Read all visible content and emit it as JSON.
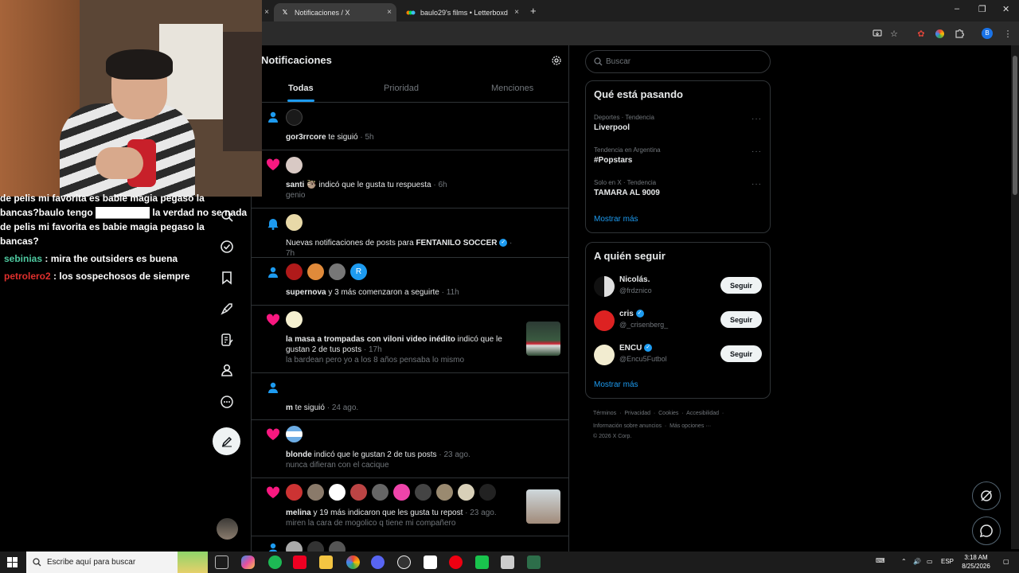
{
  "browser": {
    "tabs": [
      {
        "title": "",
        "close": "×"
      },
      {
        "title": "Notificaciones / X",
        "close": "×",
        "favicon": "x-logo-icon"
      },
      {
        "title": "baulo29's films • Letterboxd",
        "close": "×",
        "favicon": "letterboxd-icon"
      }
    ],
    "new_tab": "+",
    "window_controls": [
      "–",
      "❐",
      "✕"
    ]
  },
  "stream_chat": {
    "lines": [
      {
        "user": "",
        "user_color": "#ffffff",
        "text": "de pelis mi favorita es babie magia pegaso la"
      },
      {
        "user": "",
        "user_color": "#ffffff",
        "text": "bancas?baulo tengo ████████ la verdad no se nada"
      },
      {
        "user": "",
        "user_color": "#ffffff",
        "text": "de pelis mi favorita es babie magia pegaso la"
      },
      {
        "user": "",
        "user_color": "#ffffff",
        "text": "bancas?"
      },
      {
        "user": "sebinias",
        "user_color": "#4ec9a0",
        "text": ": mira the outsiders es buena"
      },
      {
        "user": "petrolero2",
        "user_color": "#e0302d",
        "text": ": los sospechosos de siempre"
      }
    ]
  },
  "main": {
    "title": "Notificaciones",
    "tabs": [
      {
        "label": "Todas",
        "active": true
      },
      {
        "label": "Prioridad",
        "active": false
      },
      {
        "label": "Menciones",
        "active": false
      }
    ],
    "notifications": [
      {
        "type": "follow",
        "icon": "person-icon",
        "user": "gor3rrcore",
        "text": " te siguió",
        "time": " · 5h",
        "sub": ""
      },
      {
        "type": "like",
        "icon": "heart-icon",
        "user": "santi 🦥",
        "text": " indicó que le gusta tu respuesta",
        "time": " · 6h",
        "sub": "genio"
      },
      {
        "type": "bell",
        "icon": "bell-icon",
        "user": "",
        "text": "Nuevas notificaciones de posts para ",
        "bold2": "FENTANILO SOCCER",
        "time": " · 7h",
        "sub": ""
      },
      {
        "type": "follow",
        "icon": "person-icon",
        "user": "supernova",
        "text": " y 3 más comenzaron a seguirte",
        "time": " · 11h",
        "sub": ""
      },
      {
        "type": "like",
        "icon": "heart-icon",
        "user": "la masa a trompadas con viloni video inédito",
        "text": " indicó que le gustan 2 de tus posts",
        "time": " · 17h",
        "sub": "la bardean pero yo a los 8 años pensaba lo mismo"
      },
      {
        "type": "follow",
        "icon": "person-icon",
        "user": "m",
        "text": " te siguió",
        "time": " · 24 ago.",
        "sub": ""
      },
      {
        "type": "like",
        "icon": "heart-icon",
        "user": "blonde",
        "text": " indicó que le gustan 2 de tus posts",
        "time": " · 23 ago.",
        "sub": "nunca difieran con el cacique"
      },
      {
        "type": "like",
        "icon": "heart-icon",
        "user": "melina",
        "text": " y 19 más indicaron que les gusta tu repost",
        "time": " · 23 ago.",
        "sub": "miren la cara de mogolico q tiene mi compañero"
      }
    ]
  },
  "right": {
    "search_placeholder": "Buscar",
    "trends_title": "Qué está pasando",
    "trends": [
      {
        "meta": "Deportes · Tendencia",
        "name": "Liverpool"
      },
      {
        "meta": "Tendencia en Argentina",
        "name": "#Popstars"
      },
      {
        "meta": "Solo en X · Tendencia",
        "name": "TAMARA AL 9009"
      }
    ],
    "trends_more": "Mostrar más",
    "who_title": "A quién seguir",
    "who": [
      {
        "name": "Nicolás.",
        "handle": "@frdznico",
        "verified": false,
        "button": "Seguir"
      },
      {
        "name": "cris",
        "handle": "@_crisenberg_",
        "verified": true,
        "button": "Seguir"
      },
      {
        "name": "ENCU",
        "handle": "@Encu5Futbol",
        "verified": true,
        "button": "Seguir"
      }
    ],
    "who_more": "Mostrar más",
    "footer": {
      "line1": [
        "Términos",
        "Privacidad",
        "Cookies",
        "Accesibilidad"
      ],
      "line2": [
        "Información sobre anuncios",
        "Más opciones ···"
      ],
      "copyright": "© 2026 X Corp."
    }
  },
  "taskbar": {
    "search_placeholder": "Escribe aquí para buscar",
    "lang": "ESP",
    "time": "3:18 AM",
    "date": "8/25/2026"
  },
  "colors": {
    "accent": "#1d9bf0",
    "like": "#f91880",
    "background": "#000000",
    "border": "#2f3336",
    "muted": "#71767b"
  }
}
